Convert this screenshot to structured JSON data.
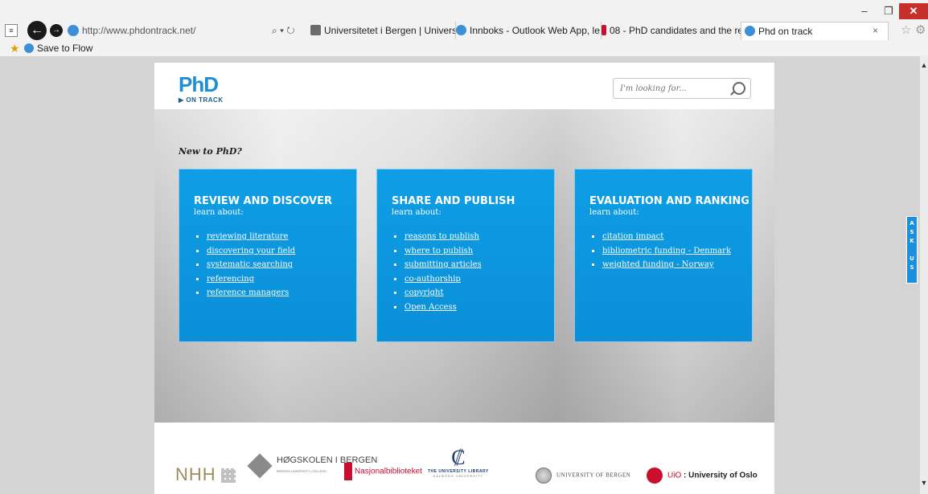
{
  "browser": {
    "window_controls": {
      "minimize": "–",
      "maximize": "❐",
      "close": "✕"
    },
    "url": "http://www.phdontrack.net/",
    "address_tools": "⌕ ▾ ↻",
    "tabs": [
      {
        "label": "Universitetet i Bergen | Universit...",
        "icon_color": "#6b6b6b"
      },
      {
        "label": "Innboks - Outlook Web App, le...",
        "icon_color": "#3d8fd8"
      },
      {
        "label": "08 - PhD candidates and the re...",
        "icon_color": "#c8102e"
      },
      {
        "label": "Phd on track",
        "icon_color": "#3d8fd8",
        "active": true
      }
    ],
    "tab_close": "×",
    "favorites_bar": {
      "item": "Save to Flow"
    }
  },
  "site": {
    "logo": {
      "main": "PhD",
      "sub": "ON TRACK"
    },
    "search": {
      "placeholder": "I'm looking for..."
    },
    "intro": "New to PhD?",
    "cards": [
      {
        "title": "REVIEW AND DISCOVER",
        "subtitle": "learn about:",
        "links": [
          "reviewing literature",
          "discovering your field",
          "systematic searching",
          "referencing",
          "reference managers"
        ]
      },
      {
        "title": "SHARE AND PUBLISH",
        "subtitle": "learn about:",
        "links": [
          "reasons to publish",
          "where to publish",
          "submitting articles",
          "co-authorship",
          "copyright",
          "Open Access"
        ]
      },
      {
        "title": "EVALUATION AND RANKING",
        "subtitle": "learn about:",
        "links": [
          "citation impact",
          "bibliometric funding - Denmark",
          "weighted funding - Norway"
        ]
      }
    ],
    "ask_us": "A S K  U S",
    "partners": {
      "nhh": "NHH",
      "hib": "HØGSKOLEN I BERGEN",
      "hib_small": "BERGEN UNIVERSITY COLLEGE",
      "nb": "Nasjonalbiblioteket",
      "ul_line1": "THE UNIVERSITY LIBRARY",
      "ul_line2": "AALBORG UNIVERSITY",
      "uib": "UNIVERSITY OF BERGEN",
      "uio_prefix": "UiO",
      "uio": "University of Oslo"
    },
    "colors": {
      "brand_blue": "#0e9ee5",
      "logo_blue": "#1c8fd6"
    }
  }
}
